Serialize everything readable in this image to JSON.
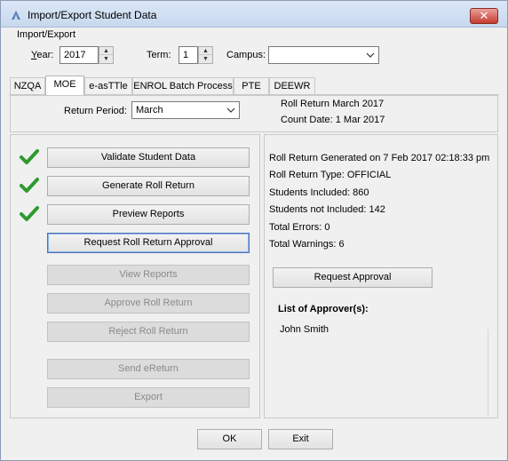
{
  "window": {
    "title": "Import/Export Student Data",
    "close_label": "✕"
  },
  "group_label": "Import/Export",
  "filters": {
    "year_label": "Year:",
    "year_value": "2017",
    "term_label": "Term:",
    "term_value": "1",
    "campus_label": "Campus:",
    "campus_value": ""
  },
  "tabs": [
    {
      "label": "NZQA",
      "active": false
    },
    {
      "label": "MOE",
      "active": true
    },
    {
      "label": "e-asTTle",
      "active": false
    },
    {
      "label": "ENROL Batch Process",
      "active": false
    },
    {
      "label": "PTE",
      "active": false
    },
    {
      "label": "DEEWR",
      "active": false
    }
  ],
  "return_period": {
    "label": "Return Period:",
    "value": "March",
    "roll_return_title": "Roll Return March 2017",
    "count_date": "Count Date: 1 Mar 2017"
  },
  "actions": [
    {
      "label": "Validate Student Data",
      "completed": true,
      "enabled": true
    },
    {
      "label": "Generate Roll Return",
      "completed": true,
      "enabled": true
    },
    {
      "label": "Preview Reports",
      "completed": true,
      "enabled": true
    },
    {
      "label": "Request Roll Return Approval",
      "completed": false,
      "enabled": true,
      "focused": true
    },
    {
      "label": "View Reports",
      "completed": false,
      "enabled": false
    },
    {
      "label": "Approve Roll Return",
      "completed": false,
      "enabled": false
    },
    {
      "label": "Reject Roll Return",
      "completed": false,
      "enabled": false
    },
    {
      "label": "Send eReturn",
      "completed": false,
      "enabled": false
    },
    {
      "label": "Export",
      "completed": false,
      "enabled": false
    }
  ],
  "status": {
    "generated": "Roll Return Generated on 7 Feb 2017 02:18:33 pm",
    "type": "Roll Return Type: OFFICIAL",
    "included": "Students Included: 860",
    "not_included": "Students not Included: 142",
    "errors": "Total Errors: 0",
    "warnings": "Total Warnings: 6",
    "request_approval_label": "Request Approval",
    "approvers_heading": "List of Approver(s):",
    "approvers": [
      "John Smith"
    ]
  },
  "footer": {
    "ok_label": "OK",
    "exit_label": "Exit"
  },
  "colors": {
    "check_green": "#2e9a2e",
    "window_bg": "#f0f0f0",
    "title_gradient_top": "#dbe7f6"
  }
}
